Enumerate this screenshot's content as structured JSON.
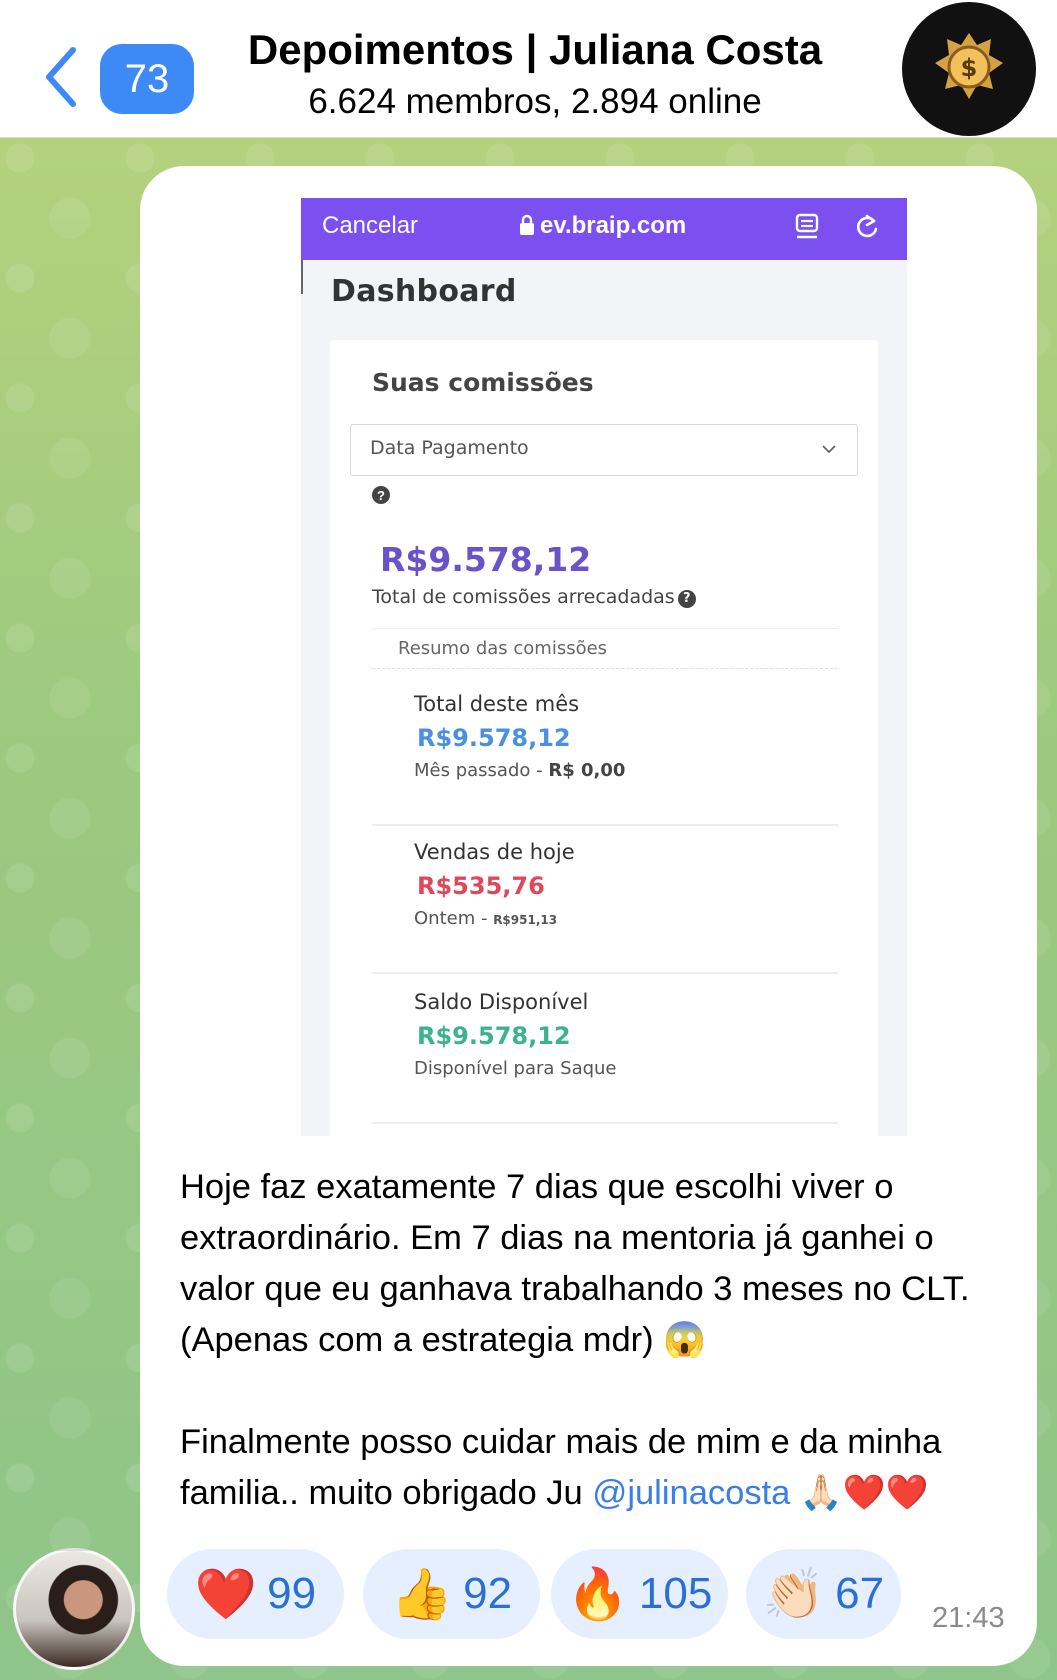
{
  "header": {
    "unread_count": "73",
    "title": "Depoimentos | Juliana Costa",
    "subtitle": "6.624 membros, 2.894 online"
  },
  "screenshot": {
    "browser": {
      "cancel": "Cancelar",
      "url": "ev.braip.com"
    },
    "page_title": "Dashboard",
    "card_title": "Suas comissões",
    "select_value": "Data Pagamento",
    "total_amount": "R$9.578,12",
    "total_label": "Total de comissões arrecadadas",
    "summary_title": "Resumo das comissões",
    "stats": [
      {
        "label": "Total deste mês",
        "value": "R$9.578,12",
        "color": "#4a90e2",
        "sub_prefix": "Mês passado - ",
        "sub_value": "R$ 0,00"
      },
      {
        "label": "Vendas de hoje",
        "value": "R$535,76",
        "color": "#e0475b",
        "sub_prefix": "Ontem - ",
        "sub_value": "R$951,13"
      },
      {
        "label": "Saldo Disponível",
        "value": "R$9.578,12",
        "color": "#3cb38a",
        "sub_prefix": "Disponível para Saque",
        "sub_value": ""
      }
    ]
  },
  "message": {
    "paragraph1": "Hoje faz exatamente 7 dias que escolhi viver o extraordinário. Em 7 dias na mentoria já ganhei o valor que eu ganhava trabalhando 3 meses no CLT. (Apenas com a estrategia mdr) 😱",
    "paragraph2_text": "Finalmente posso cuidar mais de mim e da minha familia.. muito obrigado Ju ",
    "mention": "@julinacosta",
    "paragraph2_end": " 🙏🏻❤️❤️",
    "time": "21:43"
  },
  "reactions": [
    {
      "emoji": "❤️",
      "count": "99"
    },
    {
      "emoji": "👍",
      "count": "92"
    },
    {
      "emoji": "🔥",
      "count": "105"
    },
    {
      "emoji": "👏🏻",
      "count": "67"
    }
  ],
  "colors": {
    "accent": "#3d8af7",
    "browser_bar": "#7b4ff0",
    "total_amount": "#6a52c9"
  }
}
